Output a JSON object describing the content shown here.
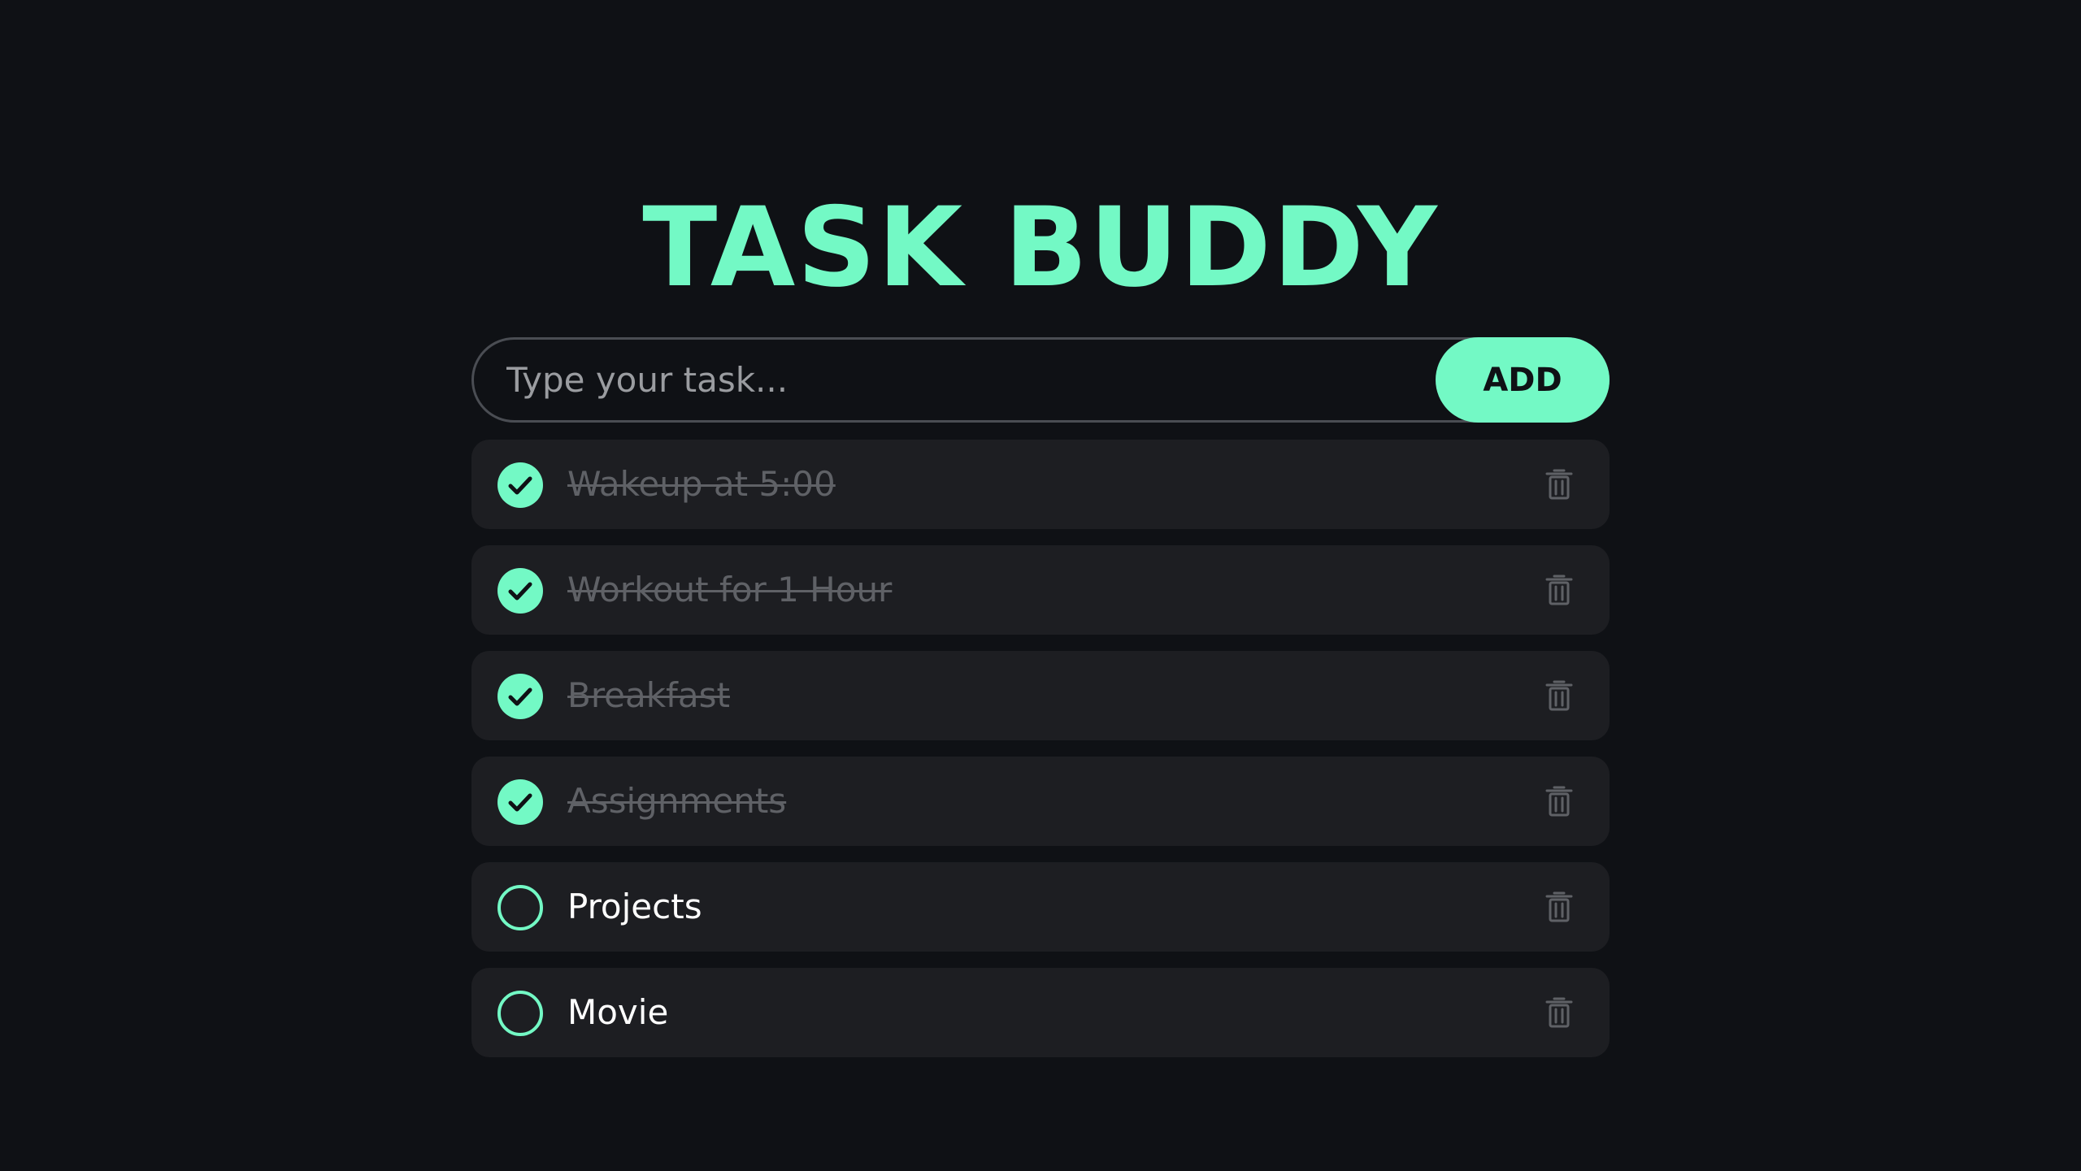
{
  "app": {
    "title": "TASK BUDDY"
  },
  "input": {
    "placeholder": "Type your task...",
    "value": ""
  },
  "add_button": {
    "label": "ADD"
  },
  "tasks": [
    {
      "text": "Wakeup at 5:00",
      "completed": true
    },
    {
      "text": "Workout for 1 Hour",
      "completed": true
    },
    {
      "text": "Breakfast",
      "completed": true
    },
    {
      "text": "Assignments",
      "completed": true
    },
    {
      "text": "Projects",
      "completed": false
    },
    {
      "text": "Movie",
      "completed": false
    }
  ],
  "icons": {
    "complete": "check-icon",
    "incomplete": "circle-icon",
    "delete": "trash-icon"
  },
  "colors": {
    "background": "#0f1115",
    "accent": "#73f9c5",
    "card": "#1d1e22",
    "muted_text": "#5f6166",
    "text": "#ffffff"
  }
}
